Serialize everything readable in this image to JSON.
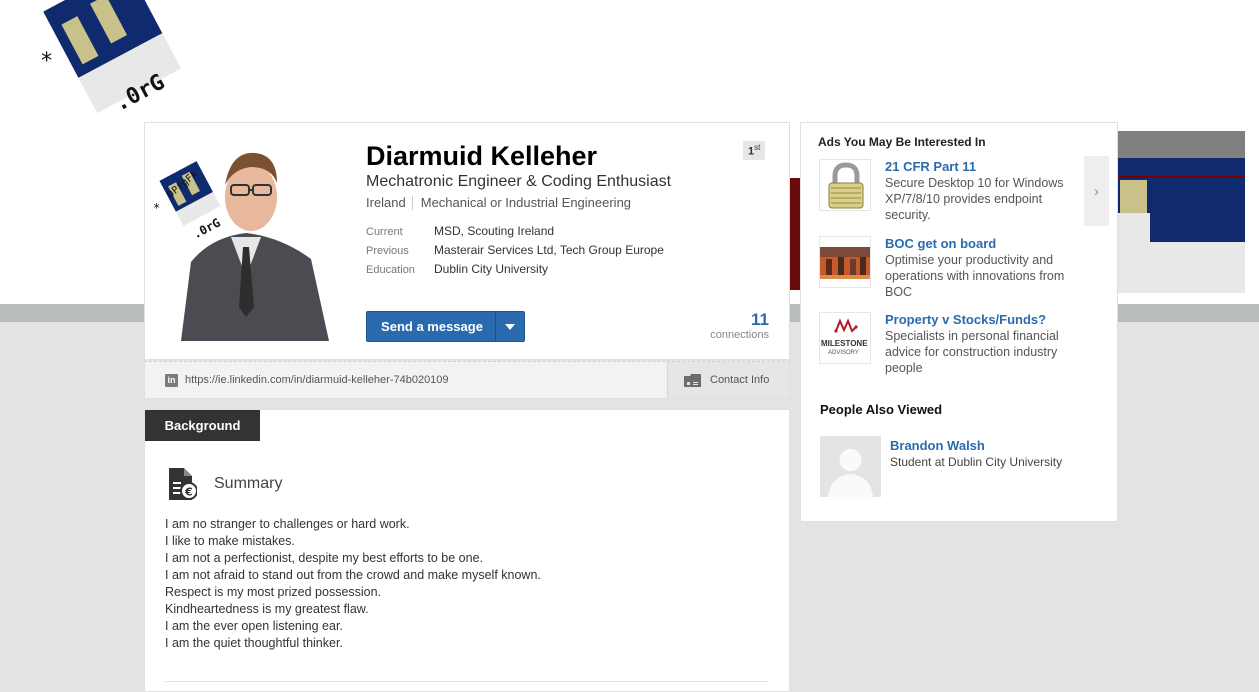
{
  "logo": {
    "text_top": "DPfgFk",
    "text_bottom": ".0rG",
    "star": "*"
  },
  "profile": {
    "name": "Diarmuid Kelleher",
    "degree": "1",
    "degree_suffix": "st",
    "headline": "Mechatronic Engineer & Coding Enthusiast",
    "location": "Ireland",
    "industry": "Mechanical or Industrial Engineering",
    "current_label": "Current",
    "current_value": "MSD, Scouting Ireland",
    "previous_label": "Previous",
    "previous_value": "Masterair Services Ltd, Tech Group Europe",
    "education_label": "Education",
    "education_value": "Dublin City University",
    "send_message": "Send a message",
    "connections_count": "11",
    "connections_label": "connections",
    "public_url": "https://ie.linkedin.com/in/diarmuid-kelleher-74b020109",
    "contact_info": "Contact Info",
    "linkedin_icon_letter": "in"
  },
  "background": {
    "tab": "Background",
    "summary_title": "Summary",
    "summary_lines": [
      "I am no stranger to challenges or hard work.",
      "I like to make mistakes.",
      "I am not a perfectionist, despite my best efforts to be one.",
      "I am not afraid to stand out from the crowd and make myself known.",
      "Respect is my most prized possession.",
      "Kindheartedness is my greatest flaw.",
      "I am the ever open listening ear.",
      "I am the quiet thoughtful thinker."
    ]
  },
  "sidebar": {
    "ads_title": "Ads You May Be Interested In",
    "ads": [
      {
        "title": "21 CFR Part 11",
        "desc": "Secure Desktop 10 for Windows XP/7/8/10 provides endpoint security.",
        "icon": "padlock-icon"
      },
      {
        "title": "BOC get on board",
        "desc": "Optimise your productivity and operations with innovations from BOC",
        "icon": "boc-photo"
      },
      {
        "title": "Property v Stocks/Funds?",
        "desc": "Specialists in personal financial advice for construction industry people",
        "icon": "milestone-logo",
        "logo_text": "MILESTONE",
        "logo_sub": "ADVISORY"
      }
    ],
    "next_arrow": "›",
    "pav_title": "People Also Viewed",
    "pav": [
      {
        "name": "Brandon Walsh",
        "subtitle": "Student at Dublin City University"
      }
    ]
  },
  "colors": {
    "link_blue": "#2a6bb0",
    "logo_navy": "#0f2a6e",
    "logo_khaki": "#c8c28a",
    "cover_dark_red": "#6b0a0a"
  }
}
